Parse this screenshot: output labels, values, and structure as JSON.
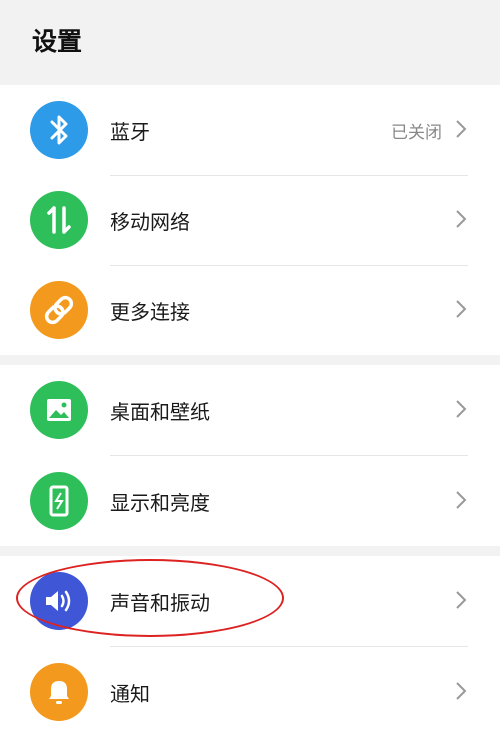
{
  "title": "设置",
  "groups": [
    {
      "items": [
        {
          "label": "蓝牙",
          "status": "已关闭",
          "icon": "bluetooth-icon",
          "color": "#2e9be8"
        },
        {
          "label": "移动网络",
          "status": "",
          "icon": "mobile-network-icon",
          "color": "#2fbf5a"
        },
        {
          "label": "更多连接",
          "status": "",
          "icon": "link-icon",
          "color": "#f39a1e"
        }
      ]
    },
    {
      "items": [
        {
          "label": "桌面和壁纸",
          "status": "",
          "icon": "wallpaper-icon",
          "color": "#2fbf5a"
        },
        {
          "label": "显示和亮度",
          "status": "",
          "icon": "display-icon",
          "color": "#2fbf5a"
        }
      ]
    },
    {
      "items": [
        {
          "label": "声音和振动",
          "status": "",
          "icon": "sound-icon",
          "color": "#3f57d6",
          "highlighted": true
        },
        {
          "label": "通知",
          "status": "",
          "icon": "bell-icon",
          "color": "#f39a1e"
        }
      ]
    }
  ]
}
